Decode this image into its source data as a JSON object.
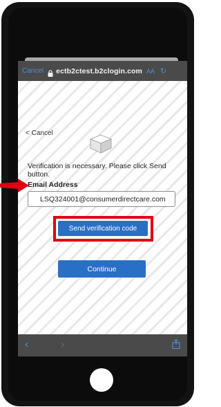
{
  "browser": {
    "cancel_label": "Cancel",
    "url": "ectb2ctest.b2clogin.com",
    "text_size_label": "AA"
  },
  "page": {
    "cancel_label": "< Cancel",
    "info_text": "Verification is necessary. Please click Send button.",
    "email_label": "Email Address",
    "email_value": "LSQ324001@consumerdirectcare.com",
    "send_button_label": "Send verification code",
    "continue_button_label": "Continue"
  },
  "colors": {
    "button_blue": "#2a6fc6",
    "highlight_red": "#e00012",
    "link_blue": "#4a8ed8"
  },
  "icons": [
    "lock-icon",
    "reload-icon",
    "box-logo-icon",
    "back-icon",
    "forward-icon",
    "share-icon",
    "red-arrow-annotation"
  ]
}
